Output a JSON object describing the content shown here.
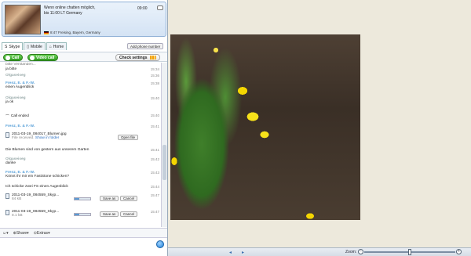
{
  "profile": {
    "mood_line1": "Wenn online chatten möglich,",
    "mood_line2": "bis 11:00 LT Germany",
    "clock": "09:00",
    "location": "8:47 Freising, Bayern, Germany"
  },
  "tabs": [
    {
      "label": "Skype",
      "icon": "skype-icon"
    },
    {
      "label": "Mobile",
      "icon": "mobile-icon"
    },
    {
      "label": "Home",
      "icon": "home-icon"
    }
  ],
  "add_phone_label": "Add phone number",
  "actions": {
    "call_label": "Call",
    "video_call_label": "Video call",
    "check_settings_label": "Check settings"
  },
  "chat": {
    "partial_top": "bitte Verstanden...",
    "messages": [
      {
        "sender": "",
        "text": "ja bitte",
        "time": "15:34"
      },
      {
        "sender": "Frenz, E. & F.-W.",
        "text": "einen Augenblick",
        "time": "15:38"
      },
      {
        "sender": "Olgaseiseg",
        "text": "ja ok",
        "time": "15:40"
      },
      {
        "sender": "",
        "text": "Call ended",
        "time": "15:40"
      },
      {
        "sender": "Frenz, E. & F.-W.",
        "text": "",
        "time": "15:41"
      },
      {
        "sender": "",
        "text": "Die Blumen sind von gestern aus unserem Garten",
        "time": "15:41"
      },
      {
        "sender": "Olgaseiseg",
        "text": "danke",
        "time": "15:42"
      },
      {
        "sender": "Frenz, E. & F.-W.",
        "text": "Könnt Ihr mir ein FastStone schicken?",
        "time": "15:43"
      },
      {
        "sender": "",
        "text": "Ich schicke zwei FS  einen Augenblick",
        "time": "15:44"
      }
    ],
    "extra_times": [
      "15:34",
      "15:36",
      "15:38",
      "15:40",
      "15:40",
      "15:41",
      "15:41",
      "15:42",
      "15:42"
    ],
    "file_received": {
      "name": "2011-03-19_084017_Blumen.jpg",
      "status": "File received.",
      "show_in_folder": "Show in folder",
      "open_label": "Open file"
    },
    "transfers": [
      {
        "name": "2011-03-19_084559_Skyp...",
        "size": "84 kB",
        "time": "15:47",
        "save_label": "Save as",
        "cancel_label": "Cancel",
        "progress": 0.3
      },
      {
        "name": "2011-03-19_084559_Skyp...",
        "size": "8.1 kB",
        "time": "15:47",
        "save_label": "Save as",
        "cancel_label": "Cancel",
        "progress": 0.3
      }
    ]
  },
  "bottom_bar": {
    "share_label": "Share",
    "extras_label": "Extras"
  },
  "viewer": {
    "zoom_label": "Zoom:",
    "zoom_level": 0.5
  }
}
